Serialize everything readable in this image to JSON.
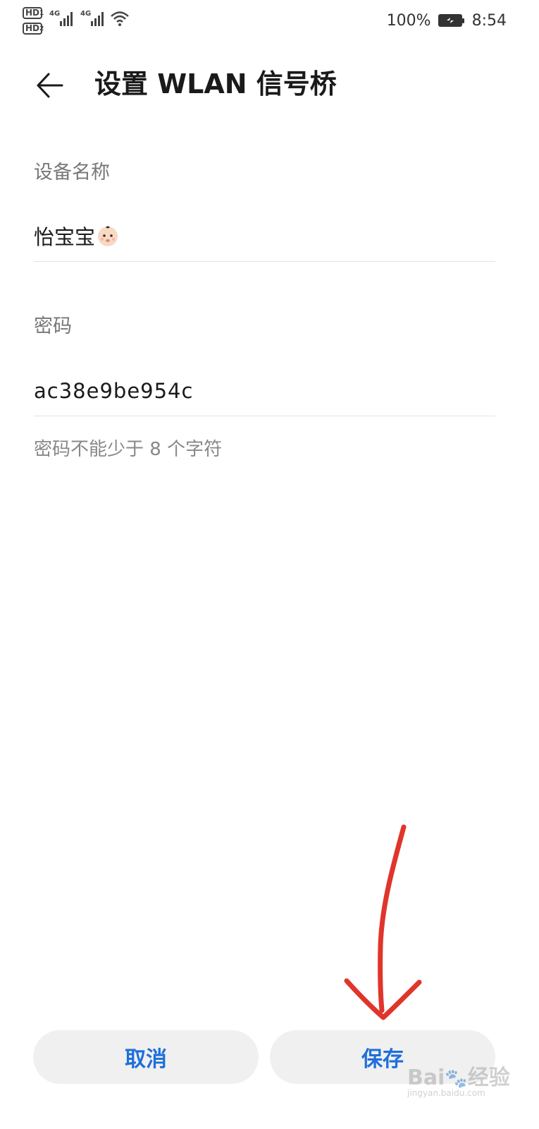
{
  "status_bar": {
    "hd1": "HD",
    "hd1_sub": "1",
    "hd2": "HD",
    "hd2_sub": "2",
    "net1": "4G",
    "net2": "4G",
    "battery": "100%",
    "time": "8:54",
    "icons": [
      "signal-icon",
      "signal-icon",
      "wifi-icon",
      "battery-charging-icon"
    ]
  },
  "header": {
    "title": "设置 WLAN 信号桥",
    "back_icon": "arrow-left-icon"
  },
  "form": {
    "device_name_label": "设备名称",
    "device_name_value": "怡宝宝",
    "device_name_emoji": "baby-face-emoji",
    "password_label": "密码",
    "password_value": "ac38e9be954c",
    "password_hint": "密码不能少于 8 个字符"
  },
  "buttons": {
    "cancel": "取消",
    "save": "保存"
  },
  "watermark": {
    "brand": "Bai",
    "brand_cn": "经验",
    "url": "jingyan.baidu.com"
  },
  "colors": {
    "accent": "#1e6fd9",
    "annotation": "#e0352b",
    "button_bg": "#f0f0f0"
  }
}
